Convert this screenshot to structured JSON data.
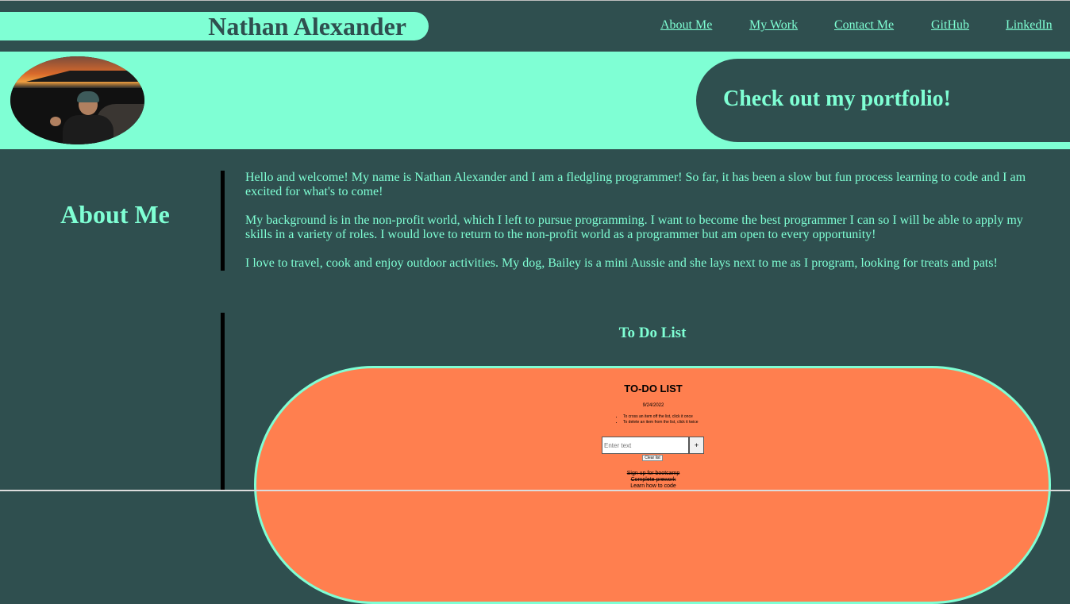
{
  "header": {
    "name": "Nathan Alexander",
    "nav": [
      "About Me",
      "My Work",
      "Contact Me",
      "GitHub",
      "LinkedIn"
    ]
  },
  "hero": {
    "cta": "Check out my portfolio!"
  },
  "about": {
    "heading": "About Me",
    "paragraphs": [
      "Hello and welcome! My name is Nathan Alexander and I am a fledgling programmer! So far, it has been a slow but fun process learning to code and I am excited for what's to come!",
      "My background is in the non-profit world, which I left to pursue programming. I want to become the best programmer I can so I will be able to apply my skills in a variety of roles. I would love to return to the non-profit world as a programmer but am open to every opportunity!",
      "I love to travel, cook and enjoy outdoor activities. My dog, Bailey is a mini Aussie and she lays next to me as I program, looking for treats and pats!"
    ]
  },
  "work": {
    "project_title": "To Do List",
    "preview": {
      "title": "TO-DO LIST",
      "date": "9/24/2022",
      "instructions": [
        "To cross an item off the list, click it once",
        "To delete an item from the list, click it twice"
      ],
      "input_placeholder": "Enter text",
      "add_label": "+",
      "clear_label": "Clear list",
      "items": [
        "Sign up for bootcamp",
        "Complete prework",
        "Learn how to code"
      ]
    }
  },
  "colors": {
    "background": "#2f4f4f",
    "accent": "#7fffd4",
    "card": "#ff7f4f"
  }
}
